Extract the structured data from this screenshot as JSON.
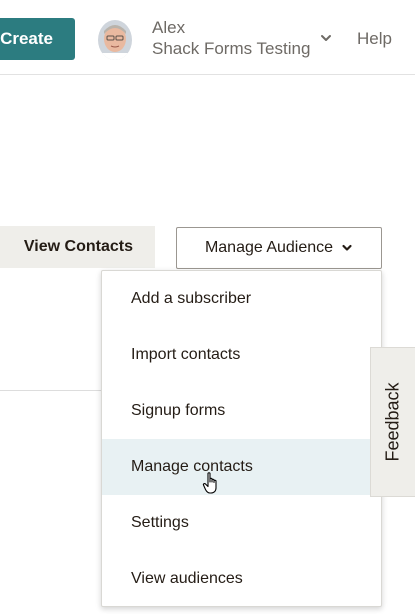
{
  "header": {
    "create_label": "Create",
    "user_name": "Alex",
    "account_name": "Shack Forms Testing",
    "help_label": "Help",
    "account_chevron_icon": "chevron-down-icon",
    "avatar_icon": "avatar"
  },
  "actions": {
    "view_contacts_label": "View Contacts",
    "manage_audience_label": "Manage Audience",
    "manage_audience_icon": "chevron-down-icon"
  },
  "menu": {
    "items": [
      {
        "label": "Add a subscriber"
      },
      {
        "label": "Import contacts"
      },
      {
        "label": "Signup forms"
      },
      {
        "label": "Manage contacts",
        "active": true
      },
      {
        "label": "Settings"
      },
      {
        "label": "View audiences"
      }
    ]
  },
  "feedback": {
    "label": "Feedback"
  },
  "colors": {
    "brand_teal": "#2c7c80",
    "text_dark": "#241c15",
    "text_muted": "#6e6a65",
    "menu_active_bg": "#e8f1f3",
    "neutral_bg": "#efeeea"
  }
}
